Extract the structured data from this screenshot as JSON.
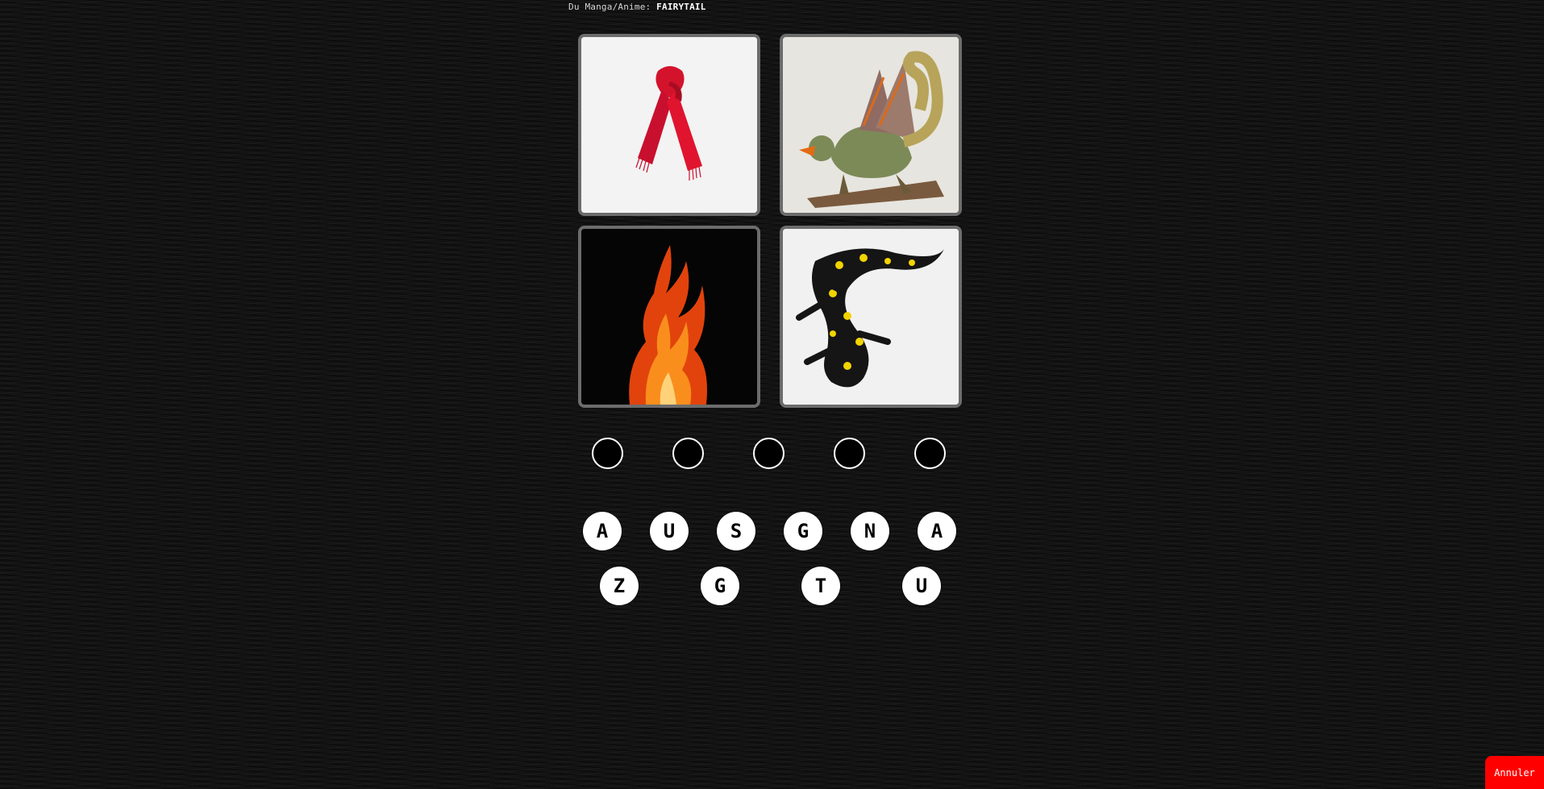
{
  "header": {
    "prefix": "Du Manga/Anime:",
    "name": "FAIRYTAIL"
  },
  "images": [
    {
      "subject": "red-scarf"
    },
    {
      "subject": "dragon-illustration"
    },
    {
      "subject": "fire-flame"
    },
    {
      "subject": "spotted-salamander"
    }
  ],
  "answer_slots": [
    "",
    "",
    "",
    "",
    ""
  ],
  "letters_row1": [
    "A",
    "U",
    "S",
    "G",
    "N",
    "A"
  ],
  "letters_row2": [
    "Z",
    "G",
    "T",
    "U"
  ],
  "cancel_label": "Annuler",
  "colors": {
    "accent": "#ff0000",
    "tile_border": "#6c6c6c",
    "letter_bg": "#ffffff"
  }
}
